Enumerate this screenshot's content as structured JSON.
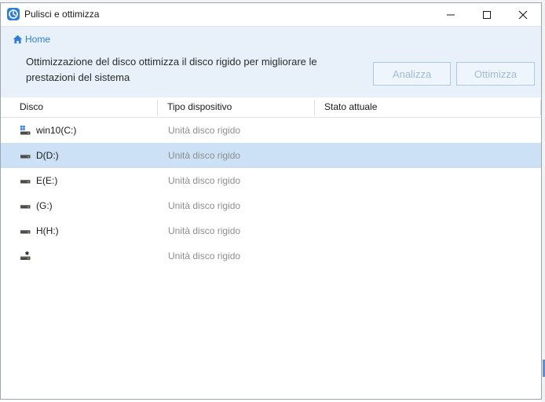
{
  "window": {
    "title": "Pulisci e ottimizza"
  },
  "header": {
    "breadcrumb_home": "Home",
    "description": "Ottimizzazione del disco ottimizza il disco rigido per migliorare le prestazioni del sistema",
    "analyze_label": "Analizza",
    "optimize_label": "Ottimizza"
  },
  "table": {
    "columns": [
      "Disco",
      "Tipo dispositivo",
      "Stato attuale"
    ],
    "rows": [
      {
        "name": "win10(C:)",
        "type": "Unità disco rigido",
        "state": "",
        "icon": "windows-drive-icon",
        "selected": false
      },
      {
        "name": "D(D:)",
        "type": "Unità disco rigido",
        "state": "",
        "icon": "hard-drive-icon",
        "selected": true
      },
      {
        "name": "E(E:)",
        "type": "Unità disco rigido",
        "state": "",
        "icon": "hard-drive-icon",
        "selected": false
      },
      {
        "name": "(G:)",
        "type": "Unità disco rigido",
        "state": "",
        "icon": "hard-drive-icon",
        "selected": false
      },
      {
        "name": "H(H:)",
        "type": "Unità disco rigido",
        "state": "",
        "icon": "hard-drive-icon",
        "selected": false
      },
      {
        "name": "",
        "type": "Unità disco rigido",
        "state": "",
        "icon": "unallocated-drive-icon",
        "selected": false
      }
    ]
  },
  "colors": {
    "accent": "#2f7dd8",
    "header_bg": "#e8f1fa",
    "selected_row": "#cce1f6"
  }
}
